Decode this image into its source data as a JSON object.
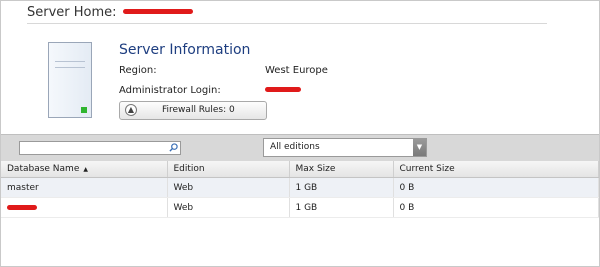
{
  "header": {
    "label": "Server Home:"
  },
  "server_info": {
    "title": "Server Information",
    "region_label": "Region:",
    "region_value": "West Europe",
    "admin_label": "Administrator Login:",
    "firewall_button": "Firewall Rules: 0"
  },
  "toolbar": {
    "search_value": "",
    "edition_selected": "All editions"
  },
  "table": {
    "columns": [
      "Database Name",
      "Edition",
      "Max Size",
      "Current Size"
    ],
    "rows": [
      {
        "name": "master",
        "edition": "Web",
        "max_size": "1 GB",
        "current_size": "0 B"
      },
      {
        "name": "",
        "edition": "Web",
        "max_size": "1 GB",
        "current_size": "0 B"
      }
    ]
  },
  "colors": {
    "title_blue": "#1e3e80",
    "redaction_red": "#e01a1a",
    "led_green": "#2fb52f"
  },
  "icons": [
    "server-icon",
    "search-icon",
    "chevron-up-icon",
    "dropdown-arrow-icon",
    "sort-up-icon"
  ]
}
